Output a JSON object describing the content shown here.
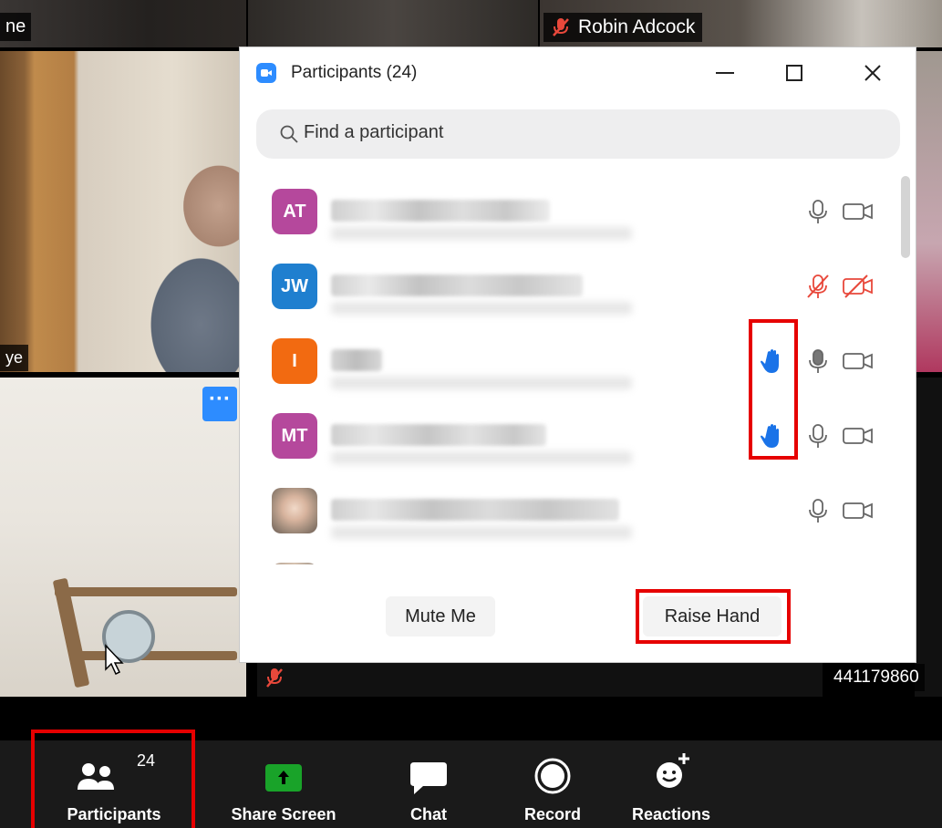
{
  "video": {
    "top_left_name": "ne",
    "top_right_name": "Robin Adcock",
    "left_mid_name": "ye",
    "phone_number": "441179860"
  },
  "participants_window": {
    "title": "Participants (24)",
    "search_placeholder": "Find a participant",
    "participants": [
      {
        "initials": "AT",
        "avatar_color": "#b5489c",
        "hand_raised": false,
        "muted": false,
        "video_off": false
      },
      {
        "initials": "JW",
        "avatar_color": "#1f7fcf",
        "hand_raised": false,
        "muted": true,
        "video_off": true
      },
      {
        "initials": "I",
        "avatar_color": "#f26a11",
        "hand_raised": true,
        "muted": false,
        "video_off": false
      },
      {
        "initials": "MT",
        "avatar_color": "#b5489c",
        "hand_raised": true,
        "muted": false,
        "video_off": false
      },
      {
        "initials": "",
        "avatar_color": "#c9b9aa",
        "hand_raised": false,
        "muted": false,
        "video_off": false
      },
      {
        "initials": "",
        "avatar_color": "#c9b9aa",
        "hand_raised": false,
        "muted": false,
        "video_off": false
      }
    ],
    "mute_me_label": "Mute Me",
    "raise_hand_label": "Raise Hand"
  },
  "toolbar": {
    "participants_label": "Participants",
    "participants_count": "24",
    "share_screen_label": "Share Screen",
    "chat_label": "Chat",
    "record_label": "Record",
    "reactions_label": "Reactions"
  },
  "colors": {
    "accent_blue": "#2d8cff",
    "muted_red": "#e8483b",
    "share_green": "#19a329",
    "highlight_red": "#e60000",
    "hand_blue": "#1a73e8"
  }
}
